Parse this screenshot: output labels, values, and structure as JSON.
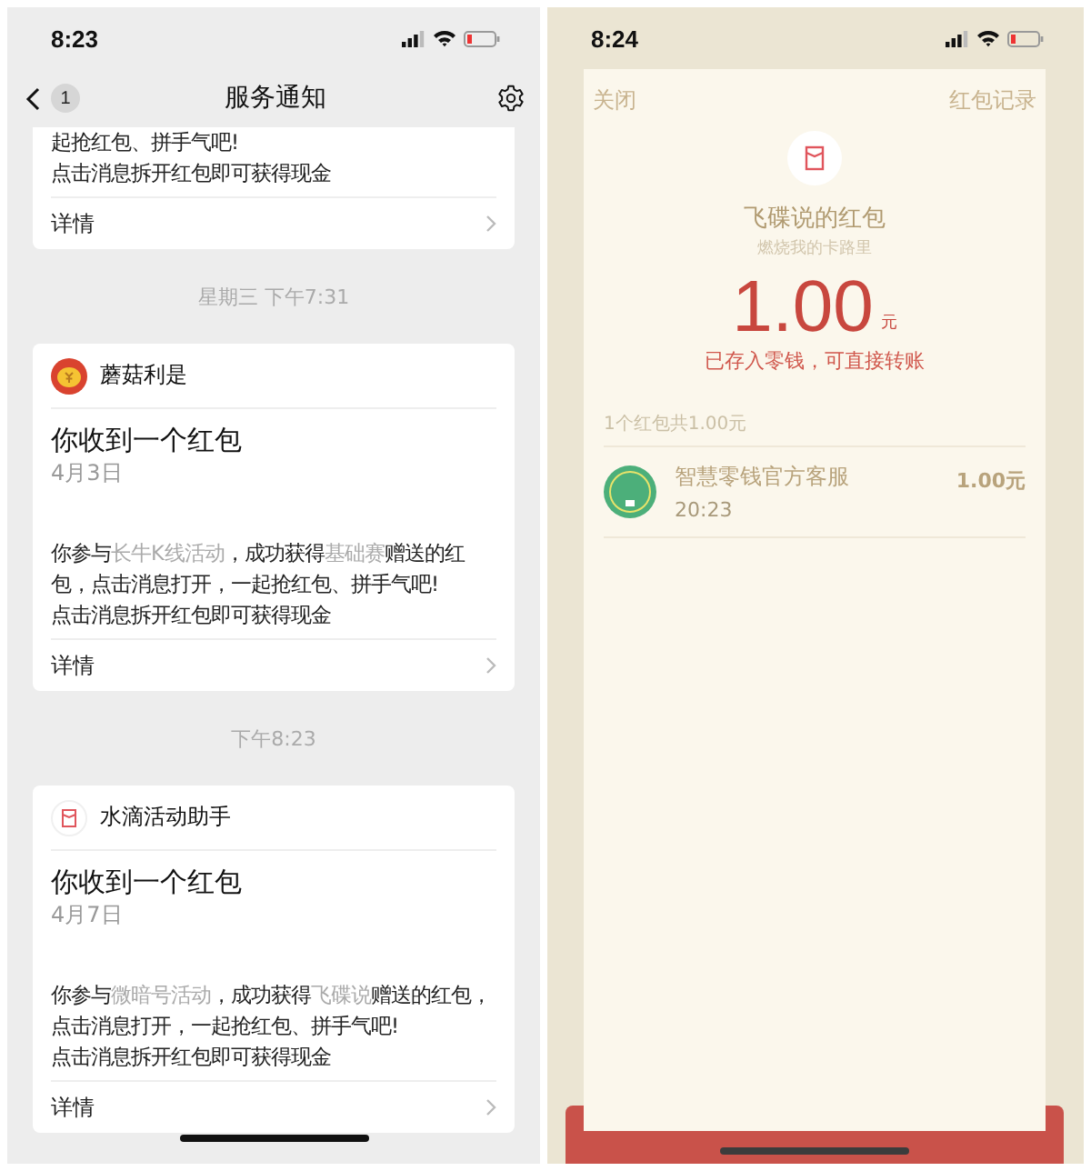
{
  "left_screen": {
    "status_bar": {
      "time": "8:23"
    },
    "nav": {
      "back_badge": "1",
      "title": "服务通知"
    },
    "messages": [
      {
        "kind": "partial",
        "body_lines": [
          "起抢红包、拼手气吧!",
          "点击消息拆开红包即可获得现金"
        ],
        "details": "详情"
      },
      {
        "kind": "timestamp",
        "text": "星期三 下午7:31"
      },
      {
        "kind": "card",
        "sender": "蘑菇利是",
        "avatar": {
          "kind": "coin"
        },
        "title": "你收到一个红包",
        "date": "4月3日",
        "body": [
          {
            "text": "你参与",
            "highlight": false
          },
          {
            "text": "长牛K线活动",
            "highlight": true
          },
          {
            "text": "，成功获得",
            "highlight": false
          },
          {
            "text": "基础赛",
            "highlight": true
          },
          {
            "text": "赠送的红包，点击消息打开，一起抢红包、拼手气吧!",
            "highlight": false
          }
        ],
        "note": "点击消息拆开红包即可获得现金",
        "details": "详情"
      },
      {
        "kind": "timestamp",
        "text": "下午8:23"
      },
      {
        "kind": "card",
        "sender": "水滴活动助手",
        "avatar": {
          "kind": "envelope"
        },
        "title": "你收到一个红包",
        "date": "4月7日",
        "body": [
          {
            "text": "你参与",
            "highlight": false
          },
          {
            "text": "微暗号活动",
            "highlight": true
          },
          {
            "text": "，成功获得",
            "highlight": false
          },
          {
            "text": "飞碟说",
            "highlight": true
          },
          {
            "text": "赠送的红包，点击消息打开，一起抢红包、拼手气吧!",
            "highlight": false
          }
        ],
        "note": "点击消息拆开红包即可获得现金",
        "details": "详情"
      }
    ]
  },
  "right_screen": {
    "status_bar": {
      "time": "8:24"
    },
    "close": "关闭",
    "records": "红包记录",
    "sender_title": "飞碟说的红包",
    "greeting": "燃烧我的卡路里",
    "amount": "1.00",
    "unit": "元",
    "deposit_note": "已存入零钱，可直接转账",
    "summary": "1个红包共1.00元",
    "receipts": [
      {
        "name": "智慧零钱官方客服",
        "time": "20:23",
        "amount": "1.00元"
      }
    ]
  }
}
